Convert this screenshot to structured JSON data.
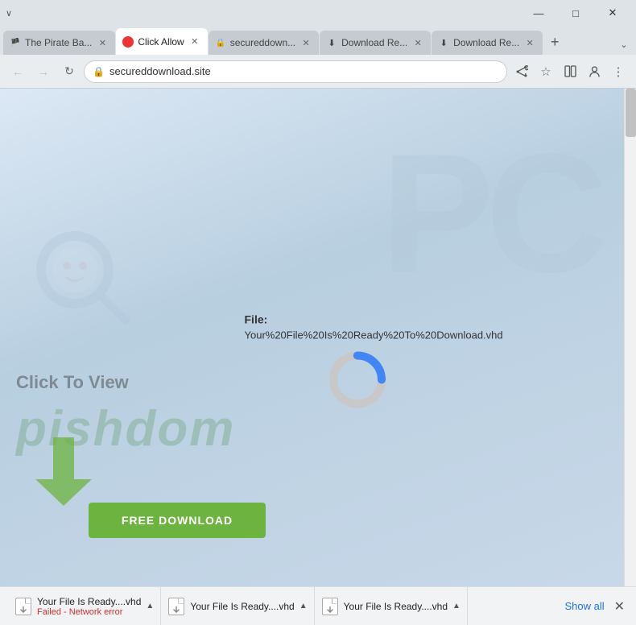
{
  "titleBar": {
    "minimize": "—",
    "restore": "□",
    "close": "✕",
    "collapseChevron": "∨"
  },
  "tabs": [
    {
      "id": "tab1",
      "label": "The Pirate Ba...",
      "favicon": "🏴",
      "active": false,
      "closeable": true
    },
    {
      "id": "tab2",
      "label": "Click Allow",
      "favicon": "🔴",
      "active": true,
      "closeable": true
    },
    {
      "id": "tab3",
      "label": "secureddown...",
      "favicon": "🔒",
      "active": false,
      "closeable": true
    },
    {
      "id": "tab4",
      "label": "Download Re...",
      "favicon": "⬇",
      "active": false,
      "closeable": true
    },
    {
      "id": "tab5",
      "label": "Download Re...",
      "favicon": "⬇",
      "active": false,
      "closeable": true
    }
  ],
  "addressBar": {
    "back": "←",
    "forward": "→",
    "refresh": "↻",
    "url": "secureddownload.site",
    "lock": "🔒",
    "share": "⎙",
    "bookmark": "☆",
    "splitscreen": "⧉",
    "profile": "👤",
    "menu": "⋮"
  },
  "page": {
    "watermarkPC": "PC",
    "clickToView": "Click To View",
    "fileLabel": "File:",
    "fileName": "Your%20File%20Is%20Ready%20To%20Download.vhd",
    "freeDownloadBtn": "FREE DOWNLOAD"
  },
  "downloads": [
    {
      "filename": "Your File Is Ready....vhd",
      "status": "Failed - Network error",
      "chevron": "▲"
    },
    {
      "filename": "Your File Is Ready....vhd",
      "status": "",
      "chevron": "▲"
    },
    {
      "filename": "Your File Is Ready....vhd",
      "status": "",
      "chevron": "▲"
    }
  ],
  "showAll": "Show all",
  "closeDownloads": "✕"
}
